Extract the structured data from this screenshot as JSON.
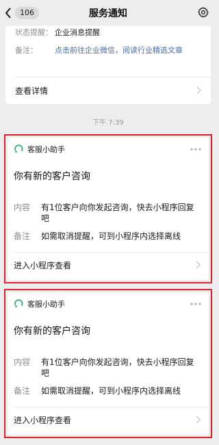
{
  "navbar": {
    "badge": "106",
    "title": "服务通知"
  },
  "prev_card": {
    "status_key": "状态提醒：",
    "status_value": "企业消息提醒",
    "note_key": "备注：",
    "note_value": "点击前往企业微信，阅读行业精选文章",
    "detail_label": "查看详情"
  },
  "timestamp": "下午 7:39",
  "notifications": [
    {
      "app_name": "客服小助手",
      "title": "你有新的客户咨询",
      "content_key": "内容",
      "content_value": "有1位客户向你发起咨询，快去小程序回复吧",
      "note_key": "备注",
      "note_value": "如需取消提醒，可到小程序内选择离线",
      "enter_label": "进入小程序查看"
    },
    {
      "app_name": "客服小助手",
      "title": "你有新的客户咨询",
      "content_key": "内容",
      "content_value": "有1位客户向你发起咨询，快去小程序回复吧",
      "note_key": "备注",
      "note_value": "如需取消提醒，可到小程序内选择离线",
      "enter_label": "进入小程序查看"
    }
  ],
  "colors": {
    "background": "#ededed",
    "link": "#4a6aa5",
    "highlight_outline": "#e3202a",
    "app_icon_green": "#2aae67"
  }
}
